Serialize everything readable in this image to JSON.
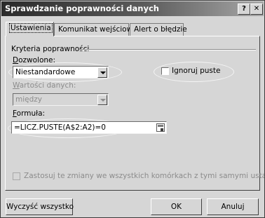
{
  "window": {
    "title": "Sprawdzanie poprawności danych"
  },
  "titlebar": {
    "help_glyph": "?",
    "close_glyph": "✕"
  },
  "tabs": [
    {
      "label": "Ustawienia",
      "active": true
    },
    {
      "label": "Komunikat wejściowy",
      "active": false
    },
    {
      "label": "Alert o błędzie",
      "active": false
    }
  ],
  "group": {
    "title": "Kryteria poprawności"
  },
  "allow": {
    "label_mnemonic": "D",
    "label_rest": "ozwolone:",
    "value": "Niestandardowe"
  },
  "ignore_blank": {
    "label_pre": "Ignoru",
    "label_mnemonic": "j",
    "label_post": " puste",
    "checked": false
  },
  "data_field": {
    "label_mnemonic": "W",
    "label_rest": "artości danych:",
    "value": "między",
    "disabled": true
  },
  "formula": {
    "label_mnemonic": "F",
    "label_rest": "ormuła:",
    "value": "=LICZ.PUSTE(A$2:A2)=0"
  },
  "apply_all": {
    "label": "Zastosuj te zmiany we wszystkich komórkach z tymi samymi ustawieniami",
    "disabled": true,
    "checked": false
  },
  "buttons": {
    "clear_all": "Wyczyść wszystko",
    "ok": "OK",
    "cancel": "Anuluj"
  },
  "colors": {
    "titlebar_dark": "#2a2a2a",
    "dialog_face": "#d6d6d6",
    "disabled_text": "#8c8c8c"
  }
}
